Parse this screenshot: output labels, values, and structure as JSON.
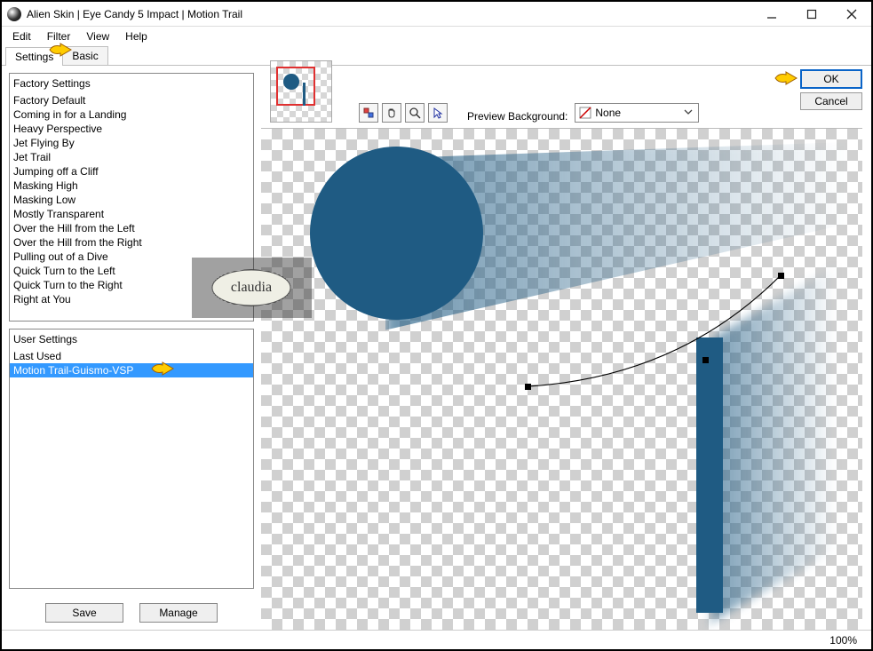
{
  "window": {
    "title": "Alien Skin | Eye Candy 5 Impact | Motion Trail"
  },
  "menu": {
    "items": [
      "Edit",
      "Filter",
      "View",
      "Help"
    ]
  },
  "tabs": {
    "items": [
      "Settings",
      "Basic"
    ],
    "active": 0
  },
  "factory": {
    "title": "Factory Settings",
    "items": [
      "Factory Default",
      "Coming in for a Landing",
      "Heavy Perspective",
      "Jet Flying By",
      "Jet Trail",
      "Jumping off a Cliff",
      "Masking High",
      "Masking Low",
      "Mostly Transparent",
      "Over the Hill from the Left",
      "Over the Hill from the Right",
      "Pulling out of a Dive",
      "Quick Turn to the Left",
      "Quick Turn to the Right",
      "Right at You"
    ]
  },
  "user": {
    "title": "User Settings",
    "items": [
      {
        "label": "Last Used",
        "selected": false
      },
      {
        "label": "Motion Trail-Guismo-VSP",
        "selected": true
      }
    ]
  },
  "buttons": {
    "save": "Save",
    "manage": "Manage",
    "ok": "OK",
    "cancel": "Cancel"
  },
  "preview": {
    "label": "Preview Background:",
    "value": "None",
    "zoom": "100%"
  },
  "icons": {
    "reset": "reset",
    "hand": "hand",
    "zoom": "zoom",
    "pointer": "pointer"
  },
  "colors": {
    "shape": "#1f5b83",
    "selection": "#3399ff"
  },
  "watermark": "claudia"
}
